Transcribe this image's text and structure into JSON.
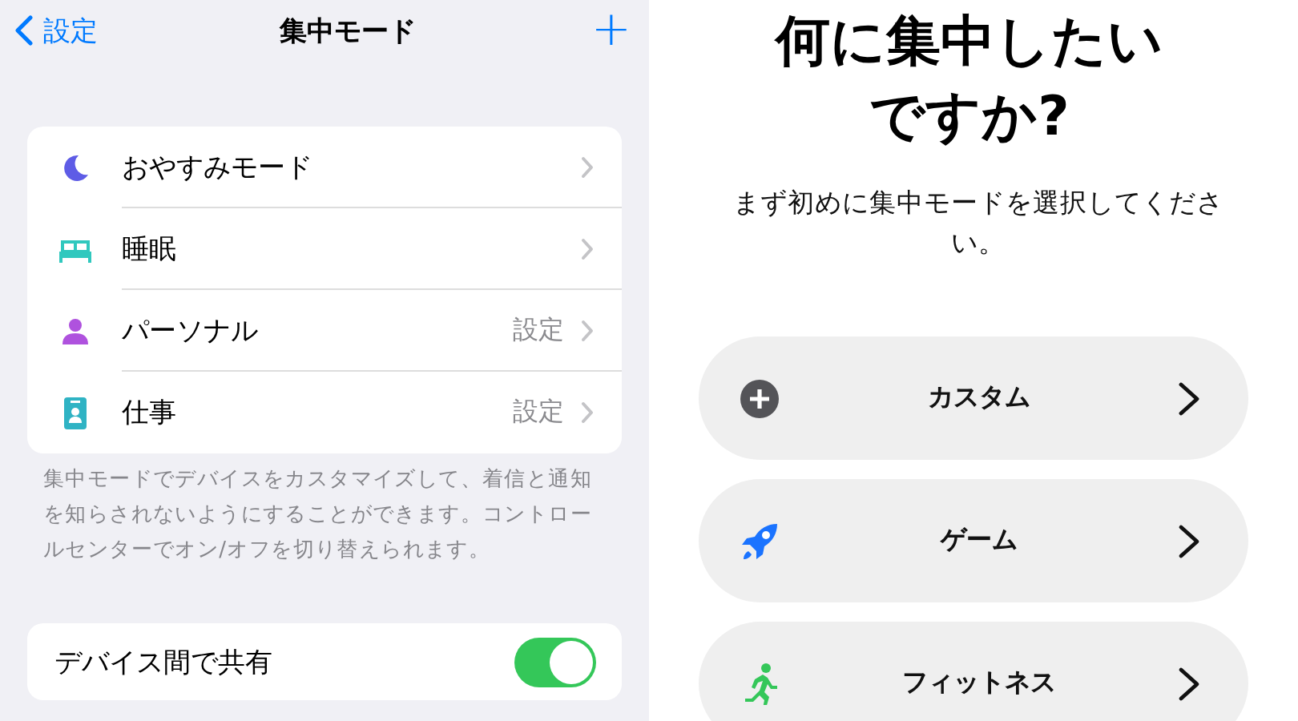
{
  "settings_screen": {
    "back_label": "設定",
    "title": "集中モード",
    "add_label": "+",
    "modes": [
      {
        "kind": "moon",
        "label": "おやすみモード"
      },
      {
        "kind": "bed",
        "label": "睡眠"
      },
      {
        "kind": "person",
        "label": "パーソナル",
        "detail": "設定"
      },
      {
        "kind": "badge",
        "label": "仕事",
        "detail": "設定"
      }
    ],
    "footer": "集中モードでデバイスをカスタマイズして、着信と通知を知らされないようにすることができます。コントロールセンターでオン/オフを切り替えられます。",
    "share_toggle": {
      "label": "デバイス間で共有",
      "on": true
    }
  },
  "setup_screen": {
    "title_lines": [
      "何に集中したい",
      "ですか?"
    ],
    "subtitle": "まず初めに集中モードを選択してください。",
    "options": [
      {
        "kind": "plus",
        "label": "カスタム"
      },
      {
        "kind": "rocket",
        "label": "ゲーム"
      },
      {
        "kind": "runner",
        "label": "フィットネス"
      }
    ]
  }
}
